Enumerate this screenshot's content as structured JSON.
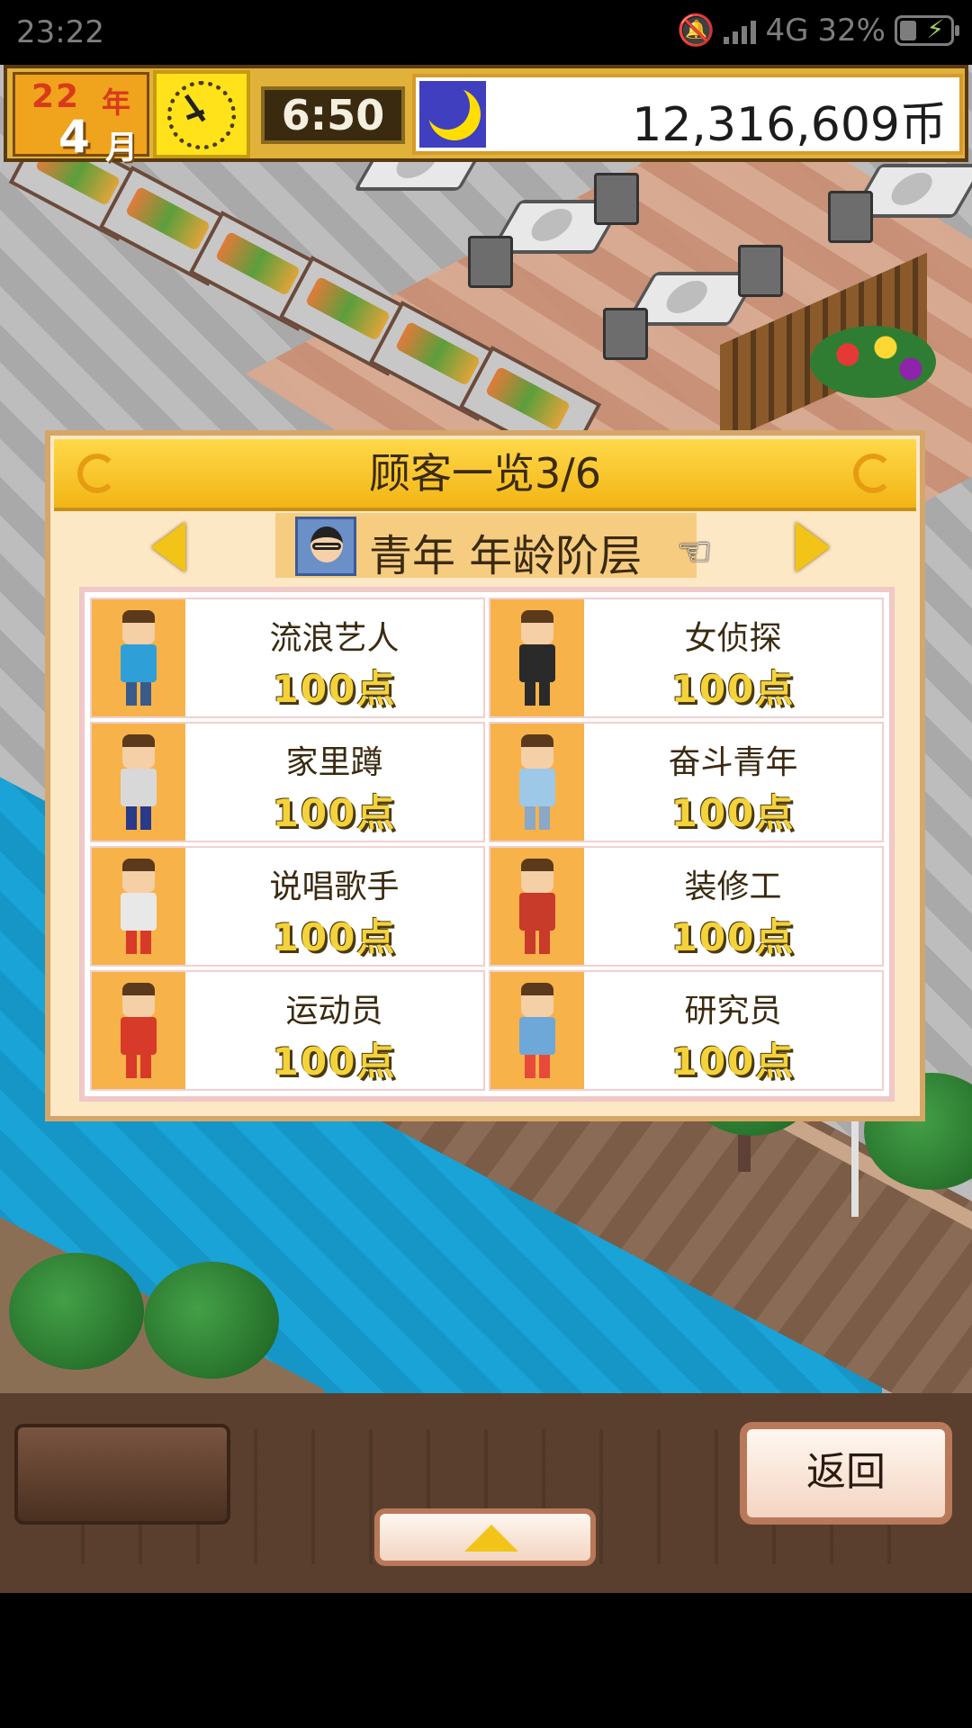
{
  "status_bar": {
    "time": "23:22",
    "network": "4G",
    "battery": "32%"
  },
  "hud": {
    "year": "22",
    "year_label": "年",
    "month": "4",
    "month_label": "月",
    "clock_time": "6:50",
    "money": "12,316,609币"
  },
  "dialog": {
    "title": "顾客一览3/6",
    "category": "青年 年龄阶层",
    "customers": [
      {
        "name": "流浪艺人",
        "points": "100点",
        "shirt": "#2f9fd8",
        "pants": "#3a5a8a"
      },
      {
        "name": "女侦探",
        "points": "100点",
        "shirt": "#2a2a2a",
        "pants": "#2a2a2a"
      },
      {
        "name": "家里蹲",
        "points": "100点",
        "shirt": "#d8d8d8",
        "pants": "#2a3a8a"
      },
      {
        "name": "奋斗青年",
        "points": "100点",
        "shirt": "#9ec8e8",
        "pants": "#8aa8c8"
      },
      {
        "name": "说唱歌手",
        "points": "100点",
        "shirt": "#e8e8e8",
        "pants": "#d83a2a"
      },
      {
        "name": "装修工",
        "points": "100点",
        "shirt": "#c83a2a",
        "pants": "#c83a2a"
      },
      {
        "name": "运动员",
        "points": "100点",
        "shirt": "#d83a2a",
        "pants": "#d83a2a"
      },
      {
        "name": "研究员",
        "points": "100点",
        "shirt": "#6ea8d8",
        "pants": "#e84a3a"
      }
    ]
  },
  "bottom": {
    "back_label": "返回"
  },
  "colors": {
    "dialog_bg": "#fde8c6",
    "title_bar": "#f2b515",
    "portrait_bg": "#f7b24a",
    "points_text": "#f4d23a"
  }
}
